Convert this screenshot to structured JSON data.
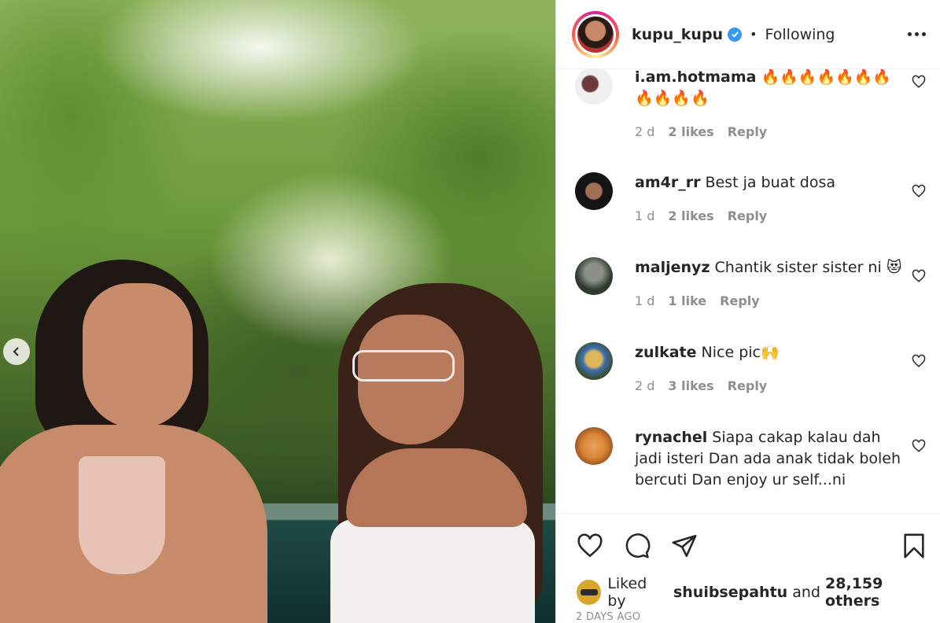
{
  "post": {
    "username": "kupu_kupu",
    "verified": true,
    "follow_status": "Following",
    "more_icon": "more-horizontal-icon"
  },
  "comments": [
    {
      "user": "i.am.hotmama",
      "text": "🔥🔥🔥🔥🔥🔥🔥🔥🔥🔥🔥",
      "time": "2 d",
      "likes": "2 likes",
      "reply": "Reply"
    },
    {
      "user": "am4r_rr",
      "text": "Best ja buat dosa",
      "time": "1 d",
      "likes": "2 likes",
      "reply": "Reply"
    },
    {
      "user": "maljenyz",
      "text": "Chantik sister sister ni 😻",
      "time": "1 d",
      "likes": "1 like",
      "reply": "Reply"
    },
    {
      "user": "zulkate",
      "text": "Nice pic🙌",
      "time": "2 d",
      "likes": "3 likes",
      "reply": "Reply"
    },
    {
      "user": "rynachel",
      "text": "Siapa cakap kalau dah jadi isteri Dan ada anak tidak boleh bercuti Dan enjoy ur self...ni",
      "time": "",
      "likes": "",
      "reply": ""
    }
  ],
  "likes": {
    "prefix": "Liked by",
    "user": "shuibsepahtu",
    "middle": "and",
    "others": "28,159 others"
  },
  "date": "2 DAYS AGO",
  "colors": {
    "verified": "#3897f0",
    "text": "#262626",
    "muted": "#8e8e8e"
  }
}
